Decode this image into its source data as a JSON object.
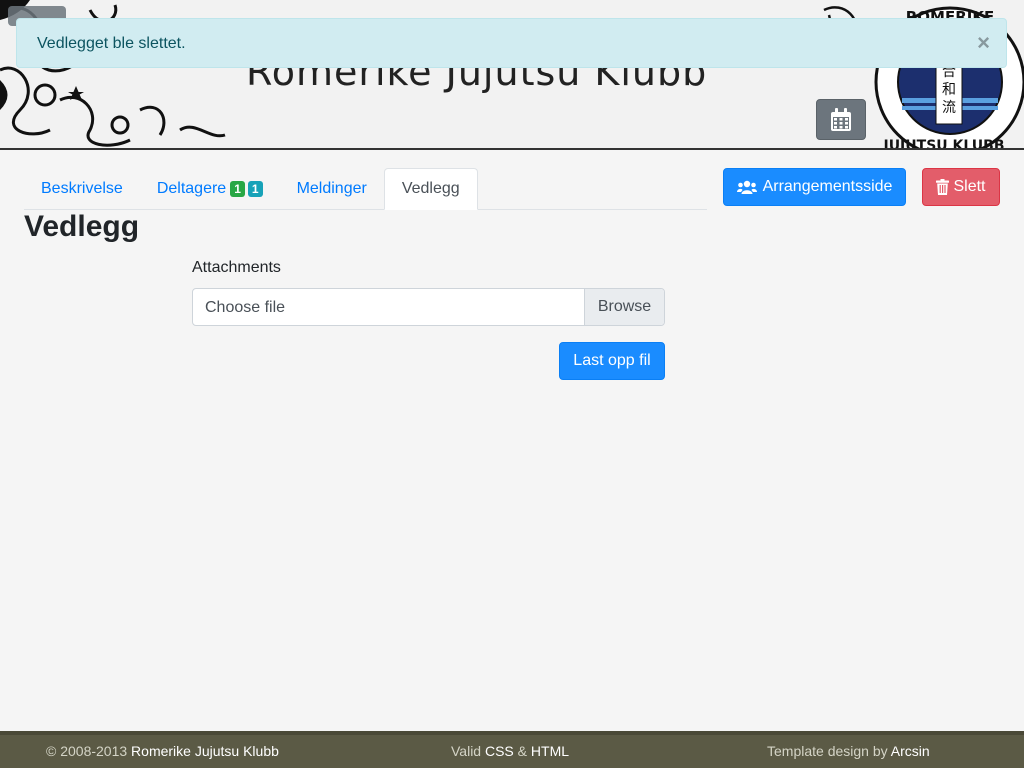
{
  "header": {
    "site_title": "Romerike Jujutsu Klubb",
    "logo_text_top": "ROMERIKE",
    "logo_text_bottom": "JUJUTSU KLUBB",
    "logo_kanji": "合和流"
  },
  "alert": {
    "message": "Vedlegget ble slettet.",
    "close_label": "×"
  },
  "tabs": [
    {
      "label": "Beskrivelse",
      "active": false
    },
    {
      "label": "Deltagere",
      "active": false,
      "badges": [
        "1",
        "1"
      ]
    },
    {
      "label": "Meldinger",
      "active": false
    },
    {
      "label": "Vedlegg",
      "active": true
    }
  ],
  "actions": {
    "event_page_label": "Arrangementsside",
    "delete_label": "Slett"
  },
  "content": {
    "heading": "Vedlegg",
    "field_label": "Attachments",
    "file_placeholder": "Choose file",
    "browse_label": "Browse",
    "upload_label": "Last opp fil"
  },
  "footer": {
    "copyright_prefix": "© 2008-2013 ",
    "copyright_name": "Romerike Jujutsu Klubb",
    "valid_prefix": "Valid ",
    "valid_css": "CSS",
    "valid_amp": " & ",
    "valid_html": "HTML",
    "template_prefix": "Template design by ",
    "template_author": "Arcsin"
  },
  "colors": {
    "primary": "#1a8cff",
    "danger": "#e35d6a",
    "alert_bg": "#d1ecf1",
    "footer_bg": "#5b5a45",
    "badge_green": "#28a745",
    "badge_teal": "#17a2b8"
  }
}
